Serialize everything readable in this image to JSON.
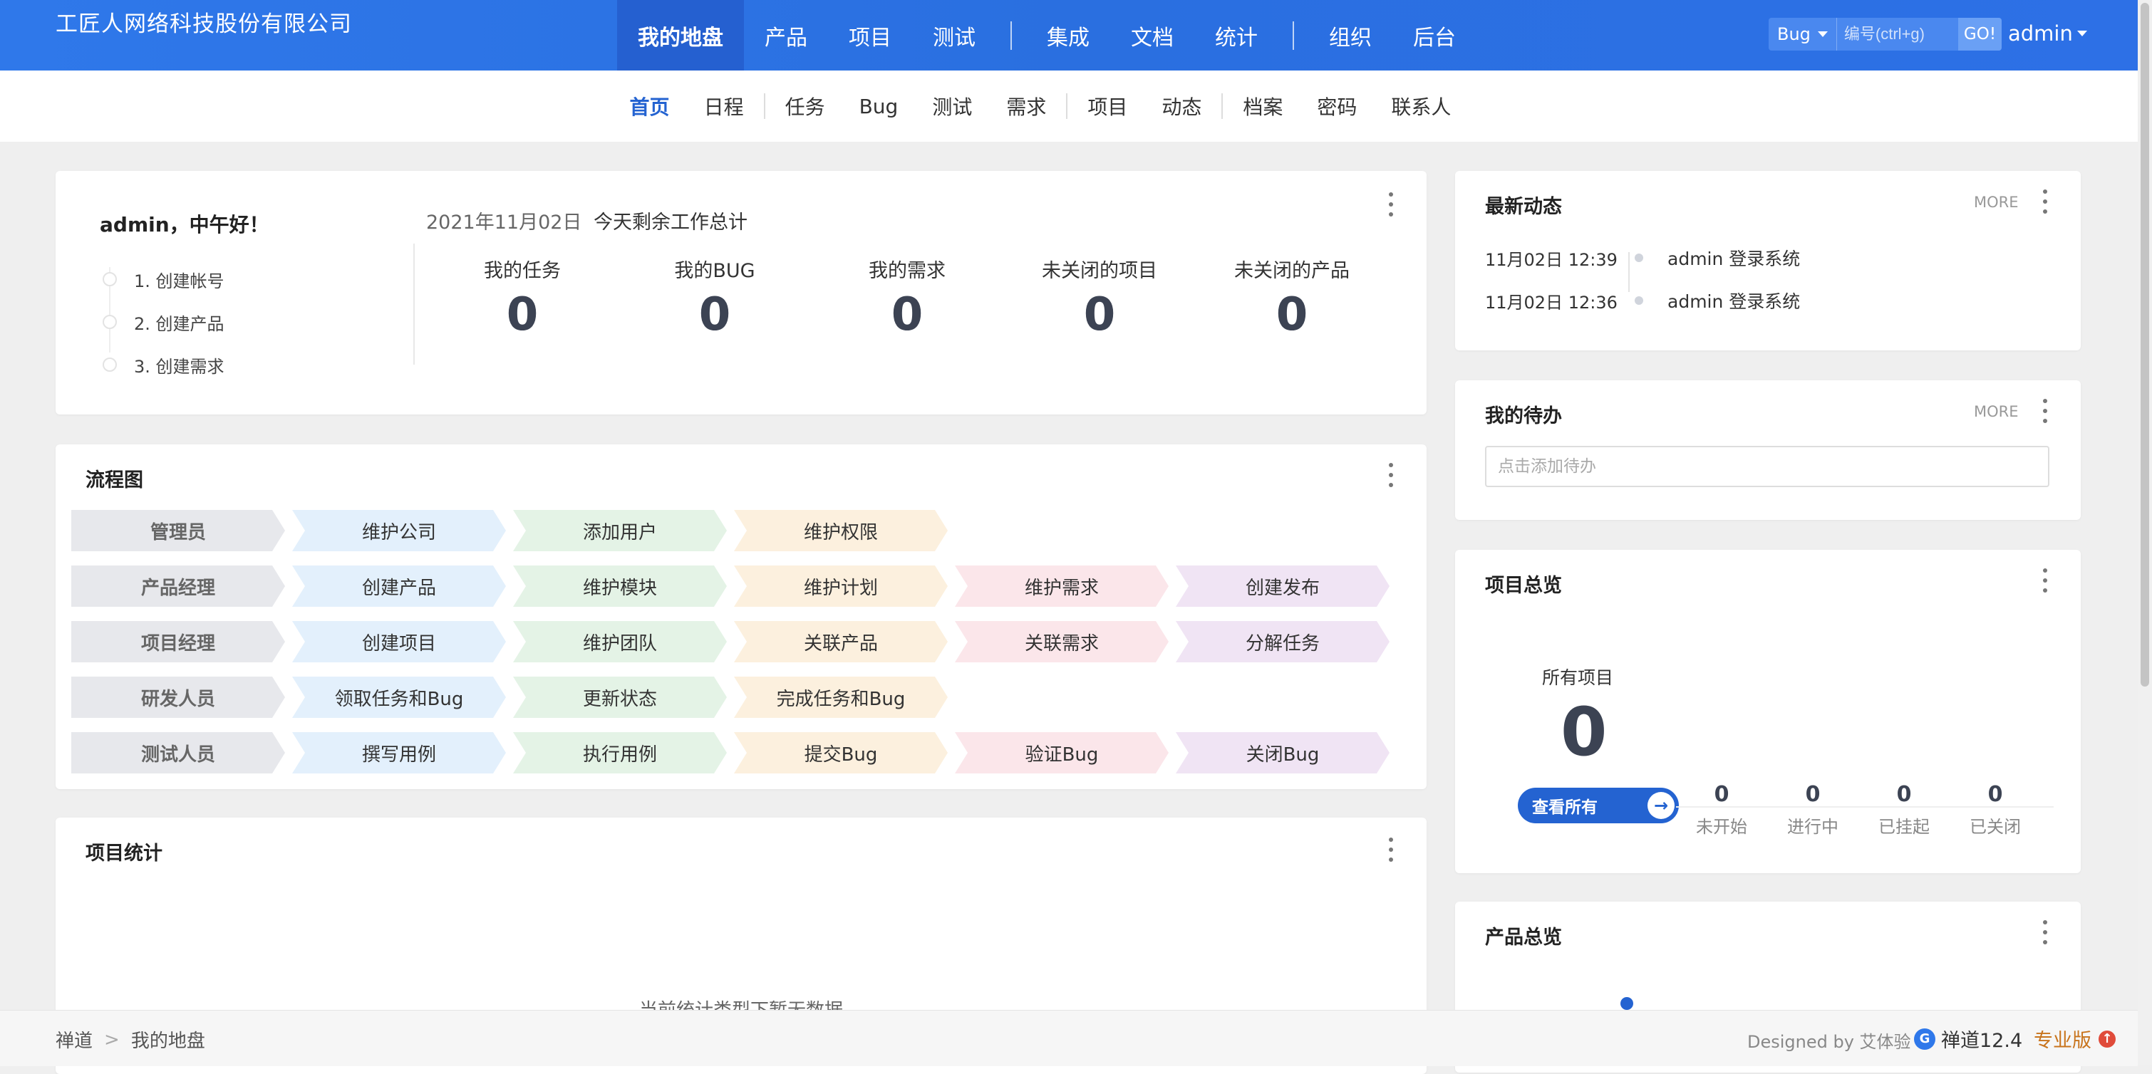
{
  "header": {
    "company": "工匠人网络科技股份有限公司",
    "nav": [
      "我的地盘",
      "产品",
      "项目",
      "测试",
      "集成",
      "文档",
      "统计",
      "组织",
      "后台"
    ],
    "search_type": "Bug",
    "search_placeholder": "编号(ctrl+g)",
    "go_label": "GO!",
    "user": "admin"
  },
  "subnav": [
    "首页",
    "日程",
    "任务",
    "Bug",
    "测试",
    "需求",
    "项目",
    "动态",
    "档案",
    "密码",
    "联系人"
  ],
  "welcome": {
    "greeting": "admin，中午好！",
    "steps": [
      "1. 创建帐号",
      "2. 创建产品",
      "3. 创建需求"
    ],
    "date": "2021年11月02日",
    "remaining_title": "今天剩余工作总计",
    "stats": [
      {
        "label": "我的任务",
        "value": "0"
      },
      {
        "label": "我的BUG",
        "value": "0"
      },
      {
        "label": "我的需求",
        "value": "0"
      },
      {
        "label": "未关闭的项目",
        "value": "0"
      },
      {
        "label": "未关闭的产品",
        "value": "0"
      }
    ]
  },
  "flow": {
    "title": "流程图",
    "rows": [
      [
        "管理员",
        "维护公司",
        "添加用户",
        "维护权限",
        "",
        ""
      ],
      [
        "产品经理",
        "创建产品",
        "维护模块",
        "维护计划",
        "维护需求",
        "创建发布"
      ],
      [
        "项目经理",
        "创建项目",
        "维护团队",
        "关联产品",
        "关联需求",
        "分解任务"
      ],
      [
        "研发人员",
        "领取任务和Bug",
        "更新状态",
        "完成任务和Bug",
        "",
        ""
      ],
      [
        "测试人员",
        "撰写用例",
        "执行用例",
        "提交Bug",
        "验证Bug",
        "关闭Bug"
      ]
    ]
  },
  "project_stats": {
    "title": "项目统计",
    "empty_text": "当前统计类型下暂无数据"
  },
  "dynamics": {
    "title": "最新动态",
    "more": "MORE",
    "items": [
      {
        "time": "11月02日 12:39",
        "text": "admin 登录系统"
      },
      {
        "time": "11月02日 12:36",
        "text": "admin 登录系统"
      }
    ]
  },
  "todo": {
    "title": "我的待办",
    "more": "MORE",
    "placeholder": "点击添加待办"
  },
  "project_overview": {
    "title": "项目总览",
    "all_label": "所有项目",
    "all_count": "0",
    "view_all": "查看所有",
    "stats": [
      {
        "value": "0",
        "label": "未开始"
      },
      {
        "value": "0",
        "label": "进行中"
      },
      {
        "value": "0",
        "label": "已挂起"
      },
      {
        "value": "0",
        "label": "已关闭"
      }
    ]
  },
  "product_overview": {
    "title": "产品总览"
  },
  "footer": {
    "crumbs": [
      "禅道",
      "我的地盘"
    ],
    "designed_by": "Designed by 艾体验",
    "brand": "禅道12.4",
    "edition": "专业版"
  }
}
